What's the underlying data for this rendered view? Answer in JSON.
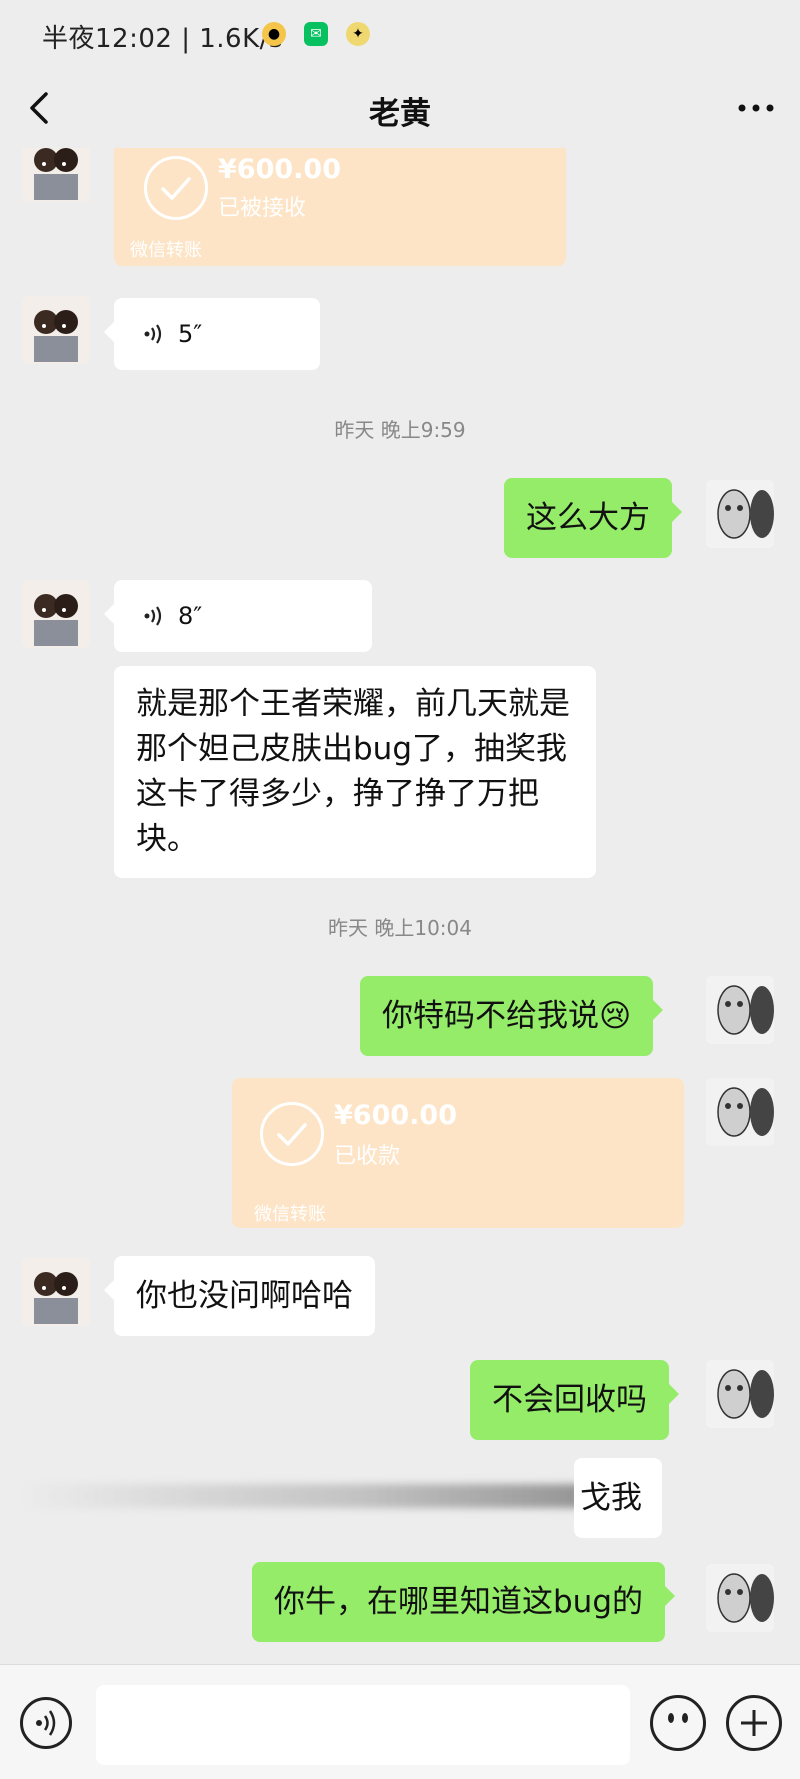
{
  "status_bar": {
    "time": "半夜12:02 | 1.6K/s",
    "icons": [
      "pet-icon",
      "wechat-icon",
      "app-icon"
    ]
  },
  "header": {
    "title": "老黄",
    "back_icon": "chevron-left-icon",
    "more_icon": "more-dots-icon"
  },
  "messages": [
    {
      "type": "transfer",
      "from": "other",
      "amount": "¥600.00",
      "status": "已被接收",
      "footer": "微信转账"
    },
    {
      "type": "voice",
      "from": "other",
      "duration": "5″"
    },
    {
      "type": "timestamp",
      "text": "昨天 晚上9:59"
    },
    {
      "type": "text",
      "from": "me",
      "text": "这么大方"
    },
    {
      "type": "voice",
      "from": "other",
      "duration": "8″"
    },
    {
      "type": "text",
      "from": "other",
      "lines": [
        "就是那个王者荣耀，前几天就是",
        "那个妲己皮肤出bug了，抽奖我",
        "这卡了得多少，挣了挣了万把",
        "块。"
      ]
    },
    {
      "type": "timestamp",
      "text": "昨天 晚上10:04"
    },
    {
      "type": "text",
      "from": "me",
      "text": "你特码不给我说",
      "emoji": "😢"
    },
    {
      "type": "transfer",
      "from": "me",
      "amount": "¥600.00",
      "status": "已收款",
      "footer": "微信转账"
    },
    {
      "type": "text",
      "from": "other",
      "text": "你也没问啊哈哈"
    },
    {
      "type": "text",
      "from": "me",
      "text": "不会回收吗"
    },
    {
      "type": "text",
      "from": "other",
      "text": "戈我",
      "note": "partially obscured"
    },
    {
      "type": "text",
      "from": "me",
      "text": "你牛，在哪里知道这bug的"
    }
  ],
  "input_bar": {
    "placeholder": "",
    "voice_icon": "voice-icon",
    "emoji_icon": "emoji-icon",
    "plus_icon": "plus-icon"
  },
  "colors": {
    "background": "#ededed",
    "my_bubble": "#95ec69",
    "other_bubble": "#ffffff",
    "transfer_card": "#fde4c6",
    "timestamp_text": "#888888"
  }
}
